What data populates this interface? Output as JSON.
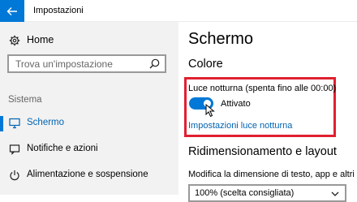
{
  "window": {
    "title": "Impostazioni"
  },
  "sidebar": {
    "home_label": "Home",
    "search_placeholder": "Trova un'impostazione",
    "section_label": "Sistema",
    "items": [
      {
        "label": "Schermo",
        "icon": "monitor-icon",
        "active": true
      },
      {
        "label": "Notifiche e azioni",
        "icon": "notifications-icon",
        "active": false
      },
      {
        "label": "Alimentazione e sospensione",
        "icon": "power-icon",
        "active": false
      }
    ]
  },
  "main": {
    "title": "Schermo",
    "color_heading": "Colore",
    "night_light_label": "Luce notturna (spenta fino alle 00:00)",
    "toggle_state": "Attivato",
    "night_light_link": "Impostazioni luce notturna",
    "scale_heading": "Ridimensionamento e layout",
    "scale_desc": "Modifica la dimensione di testo, app e altri ele",
    "scale_value": "100% (scelta consigliata)"
  },
  "colors": {
    "accent": "#0078d7",
    "link": "#0063b1",
    "highlight_border": "#e02030",
    "sidebar_bg": "#f2f2f2"
  }
}
